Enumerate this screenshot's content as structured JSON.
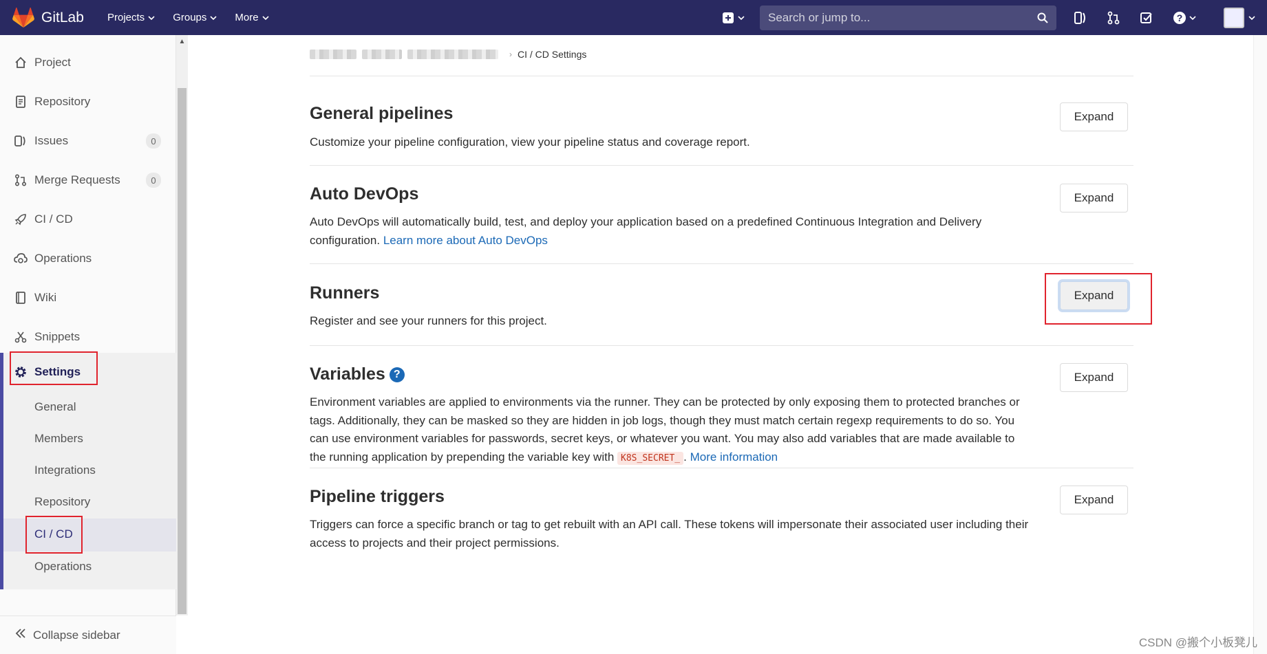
{
  "navbar": {
    "brand": "GitLab",
    "menus": [
      "Projects",
      "Groups",
      "More"
    ],
    "search_placeholder": "Search or jump to...",
    "bg_color": "#292961"
  },
  "sidebar": {
    "items": [
      {
        "label": "Project",
        "icon": "home-icon"
      },
      {
        "label": "Repository",
        "icon": "document-icon"
      },
      {
        "label": "Issues",
        "icon": "issues-icon",
        "count": "0"
      },
      {
        "label": "Merge Requests",
        "icon": "merge-request-icon",
        "count": "0"
      },
      {
        "label": "CI / CD",
        "icon": "rocket-icon"
      },
      {
        "label": "Operations",
        "icon": "cloud-gear-icon"
      },
      {
        "label": "Wiki",
        "icon": "book-icon"
      },
      {
        "label": "Snippets",
        "icon": "scissors-icon"
      }
    ],
    "settings": {
      "label": "Settings",
      "sub_items": [
        "General",
        "Members",
        "Integrations",
        "Repository",
        "CI / CD",
        "Operations"
      ],
      "active_sub": "CI / CD"
    },
    "collapse_label": "Collapse sidebar"
  },
  "breadcrumb": {
    "current": "CI / CD Settings"
  },
  "sections": [
    {
      "title": "General pipelines",
      "desc": "Customize your pipeline configuration, view your pipeline status and coverage report.",
      "button": "Expand"
    },
    {
      "title": "Auto DevOps",
      "desc": "Auto DevOps will automatically build, test, and deploy your application based on a predefined Continuous Integration and Delivery configuration.",
      "link": "Learn more about Auto DevOps",
      "button": "Expand"
    },
    {
      "title": "Runners",
      "desc": "Register and see your runners for this project.",
      "button": "Expand"
    },
    {
      "title": "Variables",
      "desc": "Environment variables are applied to environments via the runner. They can be protected by only exposing them to protected branches or tags. Additionally, they can be masked so they are hidden in job logs, though they must match certain regexp requirements to do so. You can use environment variables for passwords, secret keys, or whatever you want. You may also add variables that are made available to the running application by prepending the variable key with",
      "code": "K8S_SECRET_",
      "link": "More information",
      "button": "Expand"
    },
    {
      "title": "Pipeline triggers",
      "desc": "Triggers can force a specific branch or tag to get rebuilt with an API call. These tokens will impersonate their associated user including their access to projects and their project permissions.",
      "button": "Expand"
    }
  ],
  "watermark": "CSDN @搬个小板凳儿",
  "colors": {
    "accent": "#4b4ba3",
    "link": "#1b69b6",
    "highlight_box": "#e0232d"
  }
}
